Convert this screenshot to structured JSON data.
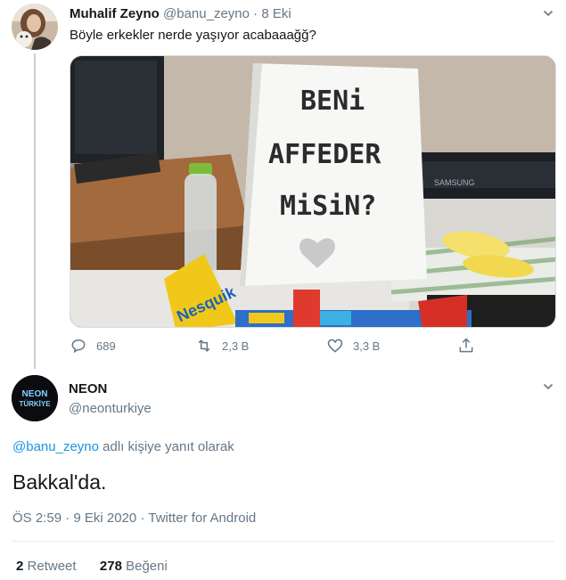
{
  "tweet1": {
    "author_name": "Muhalif Zeyno",
    "author_handle": "@banu_zeyno",
    "separator": "·",
    "date": "8 Eki",
    "text": "Böyle erkekler nerde yaşıyor acabaaağğ?",
    "media": {
      "sign_lines": [
        "BENi",
        "AFFEDER",
        "MiSiN?"
      ],
      "monitor_brand": "SAMSUNG",
      "candy_brand": "Nesquik"
    },
    "actions": {
      "replies": "689",
      "retweets": "2,3 B",
      "likes": "3,3 B"
    }
  },
  "tweet2": {
    "avatar_text_top": "NEON",
    "avatar_text_bottom": "TÜRKİYE",
    "author_name": "NEON",
    "author_handle": "@neonturkiye",
    "reply_handle": "@banu_zeyno",
    "reply_suffix": " adlı kişiye yanıt olarak",
    "text": "Bakkal'da.",
    "time": "ÖS 2:59",
    "date": "9 Eki 2020",
    "source": "Twitter for Android",
    "retweet_count": "2",
    "retweet_label": "Retweet",
    "like_count": "278",
    "like_label": "Beğeni"
  },
  "colors": {
    "link": "#1b95e0",
    "muted": "#657786",
    "text": "#14171a"
  }
}
